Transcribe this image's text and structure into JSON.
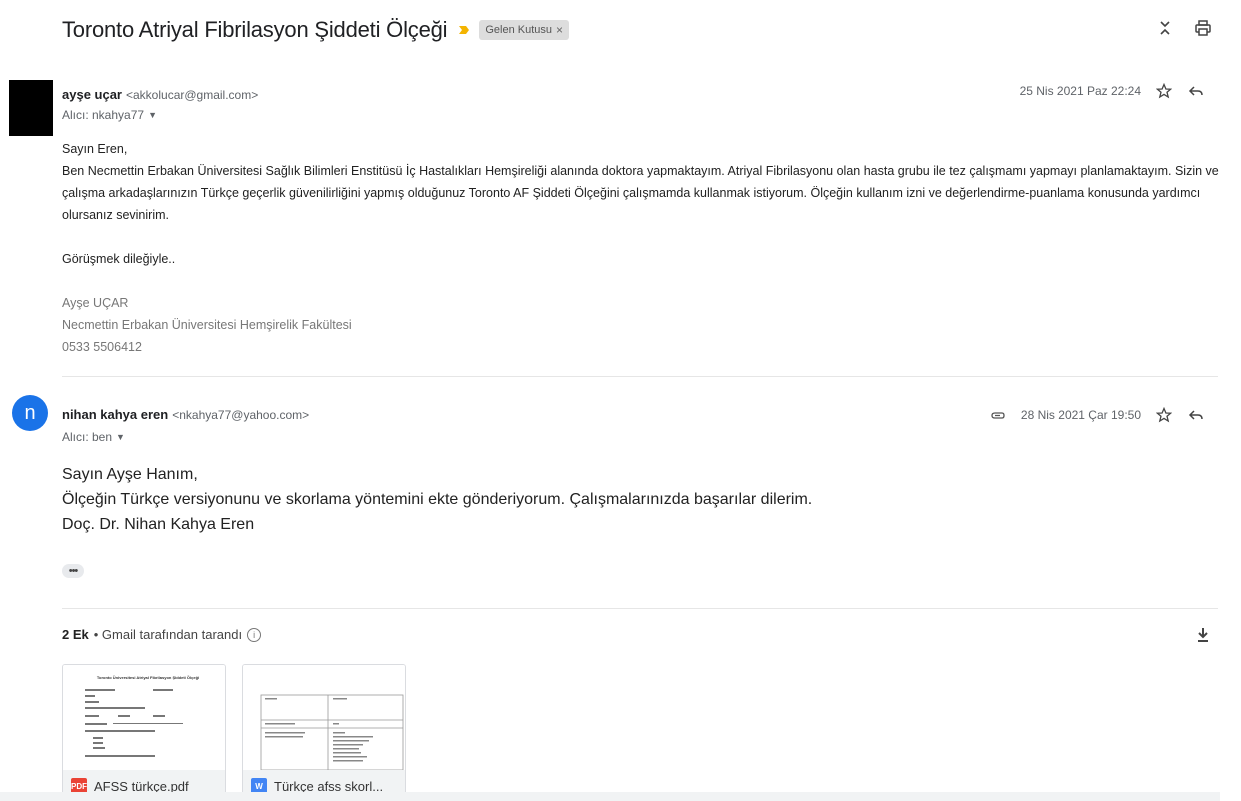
{
  "thread": {
    "subject": "Toronto Atriyal Fibrilasyon Şiddeti Ölçeği",
    "label": "Gelen Kutusu",
    "label_close": "×",
    "colors": {
      "importance": "#f4b400",
      "avatar_blue": "#1a73e8"
    }
  },
  "messages": [
    {
      "sender_name": "ayşe uçar",
      "sender_email": "<akkolucar@gmail.com>",
      "to": "Alıcı: nkahya77",
      "date": "25 Nis 2021 Paz 22:24",
      "body": {
        "greeting": "Sayın Eren,",
        "paragraph": "Ben Necmettin Erbakan Üniversitesi Sağlık Bilimleri Enstitüsü İç Hastalıkları Hemşireliği alanında doktora yapmaktayım. Atriyal Fibrilasyonu olan hasta grubu ile tez çalışmamı yapmayı planlamaktayım. Sizin ve çalışma arkadaşlarınızın Türkçe geçerlik güvenilirliğini yapmış olduğunuz Toronto AF Şiddeti Ölçeğini çalışmamda kullanmak istiyorum. Ölçeğin kullanım izni ve değerlendirme-puanlama konusunda yardımcı olursanız sevinirim.",
        "closing": "Görüşmek dileğiyle..",
        "signature": [
          "Ayşe UÇAR",
          "Necmettin Erbakan Üniversitesi Hemşirelik Fakültesi",
          "0533 5506412"
        ]
      }
    },
    {
      "avatar_letter": "n",
      "sender_name": "nihan kahya eren",
      "sender_email": "<nkahya77@yahoo.com>",
      "to": "Alıcı: ben",
      "date": "28 Nis 2021 Çar 19:50",
      "body": {
        "lines": [
          "Sayın Ayşe Hanım,",
          "Ölçeğin Türkçe versiyonunu ve skorlama yöntemini ekte gönderiyorum. Çalışmalarınızda başarılar dilerim.",
          "Doç. Dr. Nihan Kahya Eren"
        ]
      },
      "trimmed": "•••"
    }
  ],
  "attachments": {
    "count_label": "2 Ek",
    "scanned_label": "• Gmail tarafından tarandı",
    "items": [
      {
        "name": "AFSS türkçe.pdf",
        "type": "PDF",
        "color": "#ea4335",
        "preview_title": "Toronto Üniversitesi Atriyal Fibrilasyon Şiddeti Ölçeği"
      },
      {
        "name": "Türkçe afss skorl...",
        "type": "W",
        "color": "#4285f4"
      }
    ]
  }
}
